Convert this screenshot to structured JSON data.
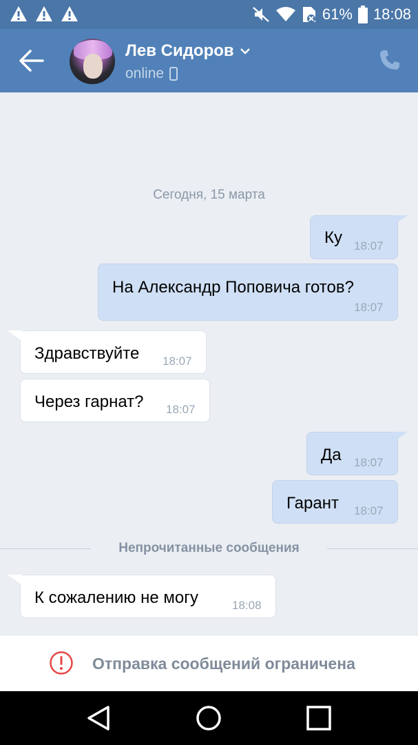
{
  "status_bar": {
    "battery_percent": "61%",
    "time": "18:08",
    "warning_icons": [
      "warning-icon",
      "warning-icon",
      "warning-icon"
    ]
  },
  "header": {
    "contact_name": "Лев Сидоров",
    "presence": "online"
  },
  "chat": {
    "date_separator": "Сегодня, 15 марта",
    "messages_before": [
      {
        "dir": "out",
        "text": "Ку",
        "time": "18:07"
      },
      {
        "dir": "out",
        "text": "На Александр Поповича готов?",
        "time": "18:07"
      },
      {
        "dir": "in",
        "text": "Здравствуйте",
        "time": "18:07"
      },
      {
        "dir": "in",
        "text": "Через гарнат?",
        "time": "18:07"
      },
      {
        "dir": "out",
        "text": "Да",
        "time": "18:07"
      },
      {
        "dir": "out",
        "text": "Гарант",
        "time": "18:07"
      }
    ],
    "unread_separator": "Непрочитанные сообщения",
    "messages_after": [
      {
        "dir": "in",
        "text": "К сожалению не могу",
        "time": "18:08"
      }
    ]
  },
  "footer": {
    "restriction_text": "Отправка сообщений ограничена"
  },
  "colors": {
    "status_bar": "#4a76a8",
    "app_bar": "#5181b8",
    "outgoing_bubble": "#cfdff5",
    "incoming_bubble": "#ffffff",
    "background": "#ebeef3",
    "restriction_icon": "#e64646"
  }
}
